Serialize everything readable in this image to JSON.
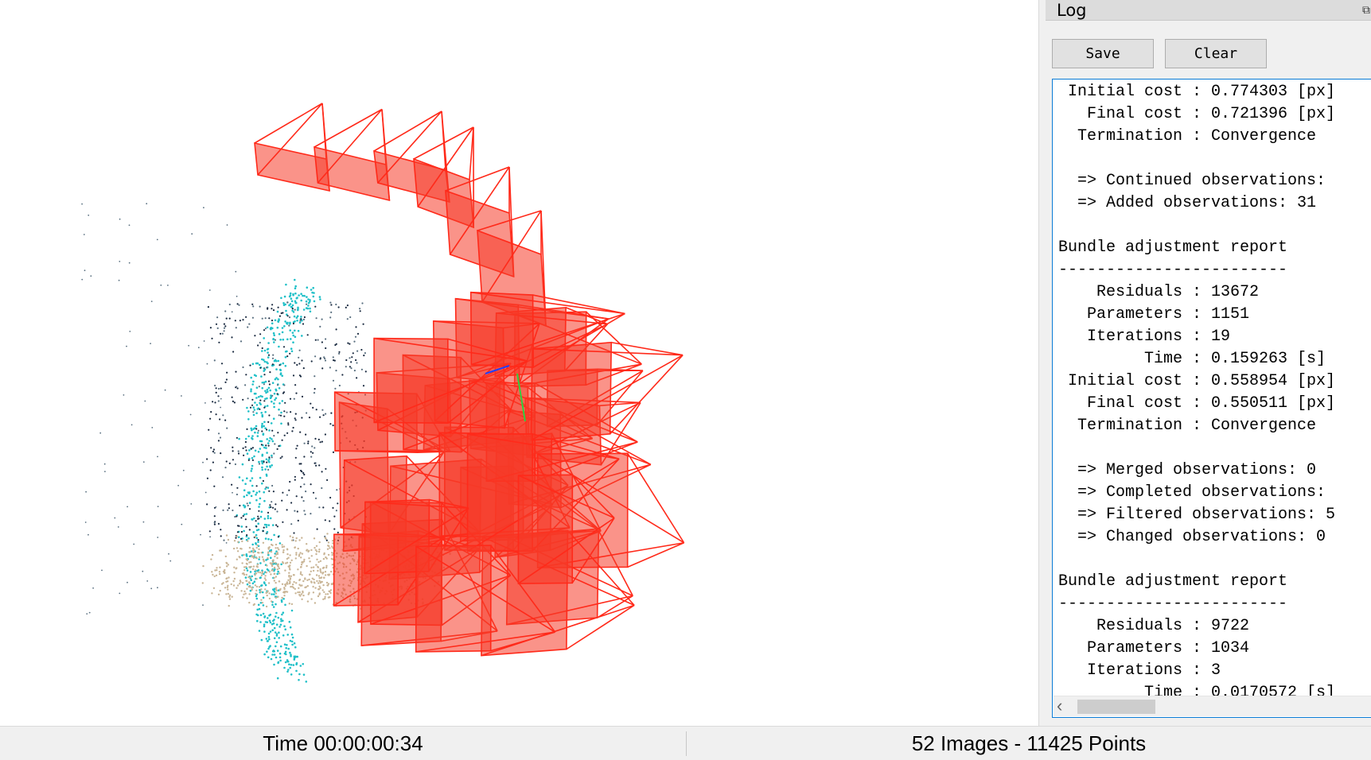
{
  "log_panel": {
    "title": "Log",
    "float_icon": "restore-icon",
    "save_label": "Save",
    "clear_label": "Clear",
    "lines": [
      " Initial cost : 0.774303 [px]",
      "   Final cost : 0.721396 [px]",
      "  Termination : Convergence",
      "",
      "  => Continued observations: ",
      "  => Added observations: 31",
      "",
      "Bundle adjustment report",
      "------------------------",
      "    Residuals : 13672",
      "   Parameters : 1151",
      "   Iterations : 19",
      "         Time : 0.159263 [s]",
      " Initial cost : 0.558954 [px]",
      "   Final cost : 0.550511 [px]",
      "  Termination : Convergence",
      "",
      "  => Merged observations: 0",
      "  => Completed observations: ",
      "  => Filtered observations: 5",
      "  => Changed observations: 0",
      "",
      "Bundle adjustment report",
      "------------------------",
      "    Residuals : 9722",
      "   Parameters : 1034",
      "   Iterations : 3",
      "         Time : 0.0170572 [s]"
    ]
  },
  "scrollbar": {
    "left_glyph": "‹",
    "right_glyph": "›"
  },
  "status_bar": {
    "time": "Time 00:00:00:34",
    "counts": "52 Images - 11425 Points"
  },
  "viewport": {
    "camera_color": "#ff2a1a",
    "camera_fill": "#f63a28",
    "point_colors": [
      "#20c0c8",
      "#1a2a40",
      "#c9b596",
      "#5a7080"
    ]
  }
}
